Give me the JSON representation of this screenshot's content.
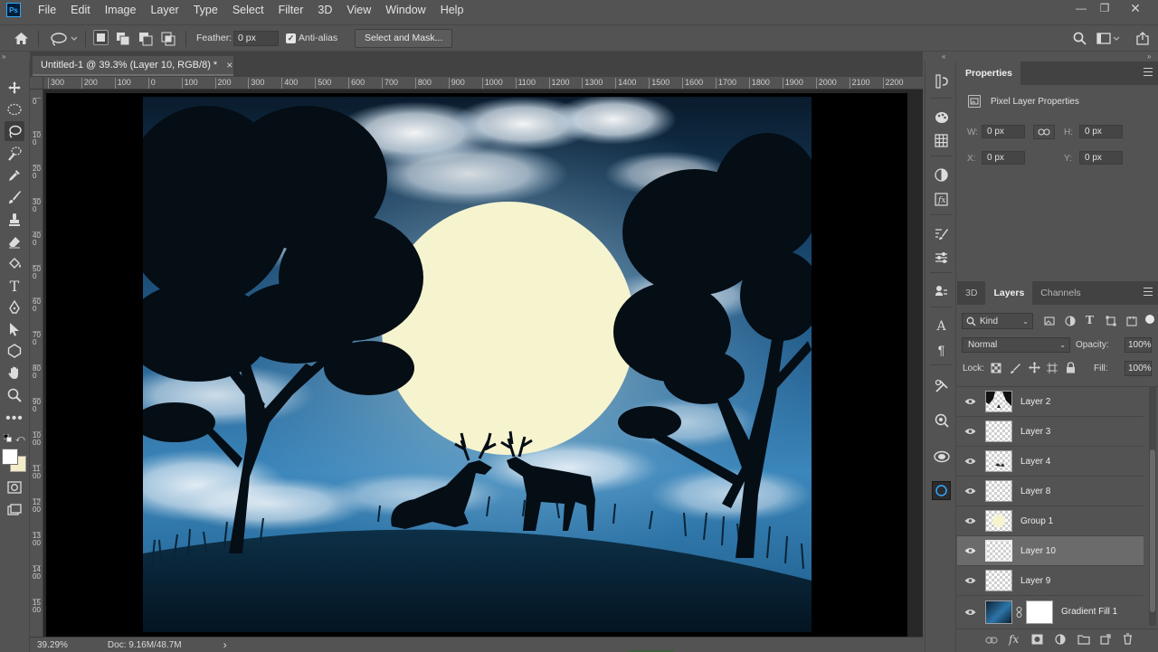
{
  "menubar": {
    "logo": "Ps",
    "items": [
      "File",
      "Edit",
      "Image",
      "Layer",
      "Type",
      "Select",
      "Filter",
      "3D",
      "View",
      "Window",
      "Help"
    ]
  },
  "options": {
    "feather_label": "Feather:",
    "feather_value": "0 px",
    "antialias_label": "Anti-alias",
    "select_mask_label": "Select and Mask..."
  },
  "document": {
    "tab_title": "Untitled-1 @ 39.3% (Layer 10, RGB/8) *",
    "close": "×"
  },
  "ruler": {
    "h_ticks": [
      "300",
      "200",
      "100",
      "0",
      "100",
      "200",
      "300",
      "400",
      "500",
      "600",
      "700",
      "800",
      "900",
      "1000",
      "1100",
      "1200",
      "1300",
      "1400",
      "1500",
      "1600",
      "1700",
      "1800",
      "1900",
      "2000",
      "2100",
      "2200"
    ],
    "v_ticks": [
      "0",
      "100",
      "200",
      "300",
      "400",
      "500",
      "600",
      "700",
      "800",
      "900",
      "1000",
      "1100",
      "1200",
      "1300",
      "1400",
      "1500"
    ]
  },
  "status": {
    "zoom": "39.29%",
    "doc": "Doc: 9.16M/48.7M",
    "arrow": "›"
  },
  "properties": {
    "tab": "Properties",
    "section": "Pixel Layer Properties",
    "w_label": "W:",
    "w_value": "0 px",
    "h_label": "H:",
    "h_value": "0 px",
    "x_label": "X:",
    "x_value": "0 px",
    "y_label": "Y:",
    "y_value": "0 px"
  },
  "layers_panel": {
    "tabs": [
      "3D",
      "Layers",
      "Channels"
    ],
    "kind_label": "Kind",
    "blend_mode": "Normal",
    "opacity_label": "Opacity:",
    "opacity_value": "100%",
    "lock_label": "Lock:",
    "fill_label": "Fill:",
    "fill_value": "100%",
    "layers": [
      {
        "name": "Layer 2"
      },
      {
        "name": "Layer 3"
      },
      {
        "name": "Layer 4"
      },
      {
        "name": "Layer 8"
      },
      {
        "name": "Group 1"
      },
      {
        "name": "Layer 10",
        "selected": true
      },
      {
        "name": "Layer 9"
      },
      {
        "name": "Gradient Fill 1"
      }
    ]
  },
  "colors": {
    "accent": "#31a8ff",
    "moon": "#f6f3cf",
    "sky": "#2d74a8"
  }
}
